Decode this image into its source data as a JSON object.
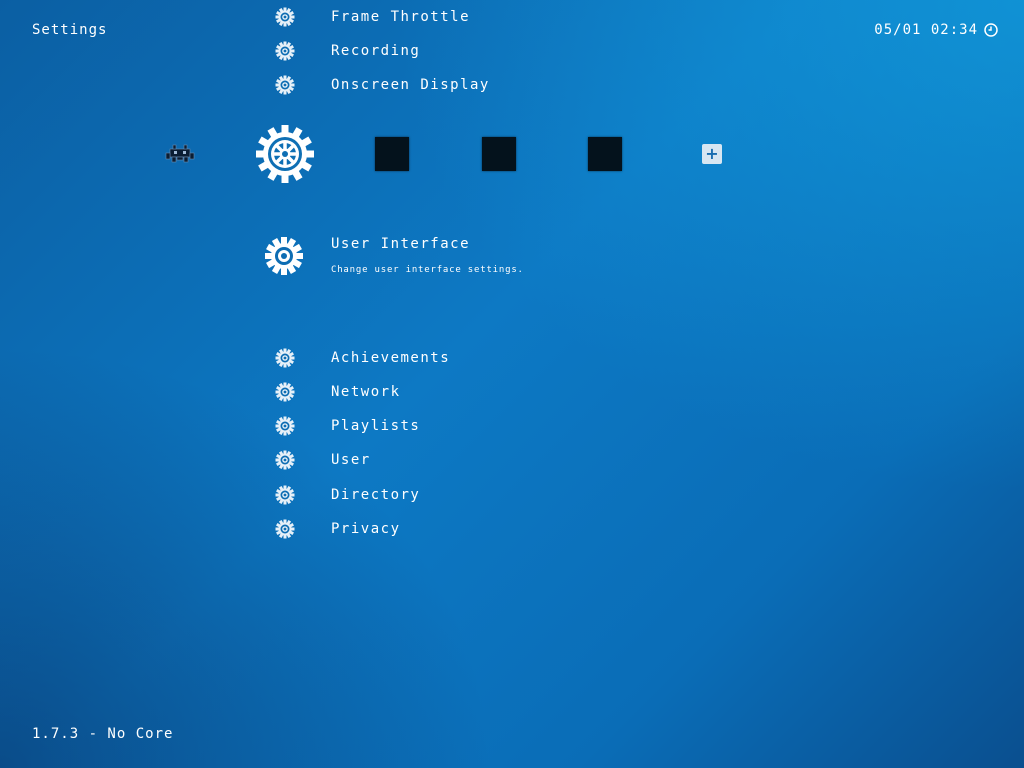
{
  "header": {
    "title": "Settings",
    "datetime": "05/01 02:34",
    "clock_icon": "clock-icon"
  },
  "footer": {
    "version": "1.7.3 - No Core"
  },
  "tabs": [
    {
      "name": "main-menu",
      "icon": "invader-icon"
    },
    {
      "name": "settings",
      "icon": "gear-icon",
      "selected": true
    },
    {
      "name": "history",
      "icon": "blank-icon"
    },
    {
      "name": "favorites",
      "icon": "blank-icon"
    },
    {
      "name": "images",
      "icon": "blank-icon"
    },
    {
      "name": "add",
      "icon": "plus-icon"
    }
  ],
  "menu": {
    "items_above": [
      {
        "label": "Frame Throttle",
        "icon": "gear-icon"
      },
      {
        "label": "Recording",
        "icon": "gear-icon"
      },
      {
        "label": "Onscreen Display",
        "icon": "gear-icon"
      }
    ],
    "selected": {
      "label": "User Interface",
      "sublabel": "Change user interface settings.",
      "icon": "gear-icon"
    },
    "items_below": [
      {
        "label": "Achievements",
        "icon": "gear-icon"
      },
      {
        "label": "Network",
        "icon": "gear-icon"
      },
      {
        "label": "Playlists",
        "icon": "gear-icon"
      },
      {
        "label": "User",
        "icon": "gear-icon"
      },
      {
        "label": "Directory",
        "icon": "gear-icon"
      },
      {
        "label": "Privacy",
        "icon": "gear-icon"
      }
    ]
  }
}
